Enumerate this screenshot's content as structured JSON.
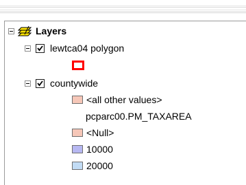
{
  "toc": {
    "root": {
      "label": "Layers",
      "icon": "layers-stack-icon"
    },
    "layer1": {
      "label": "lewtca04 polygon",
      "checked": true,
      "symbol_color": "#ff0000"
    },
    "layer2": {
      "label": "countywide",
      "checked": true,
      "legend": [
        {
          "label": "<all other values>",
          "color": "#f6c7b8"
        },
        {
          "label": "pcparc00.PM_TAXAREA",
          "color": null
        },
        {
          "label": "<Null>",
          "color": "#f6c7b8"
        },
        {
          "label": "10000",
          "color": "#b7b8f2"
        },
        {
          "label": "20000",
          "color": "#c2dcf5"
        }
      ]
    }
  }
}
